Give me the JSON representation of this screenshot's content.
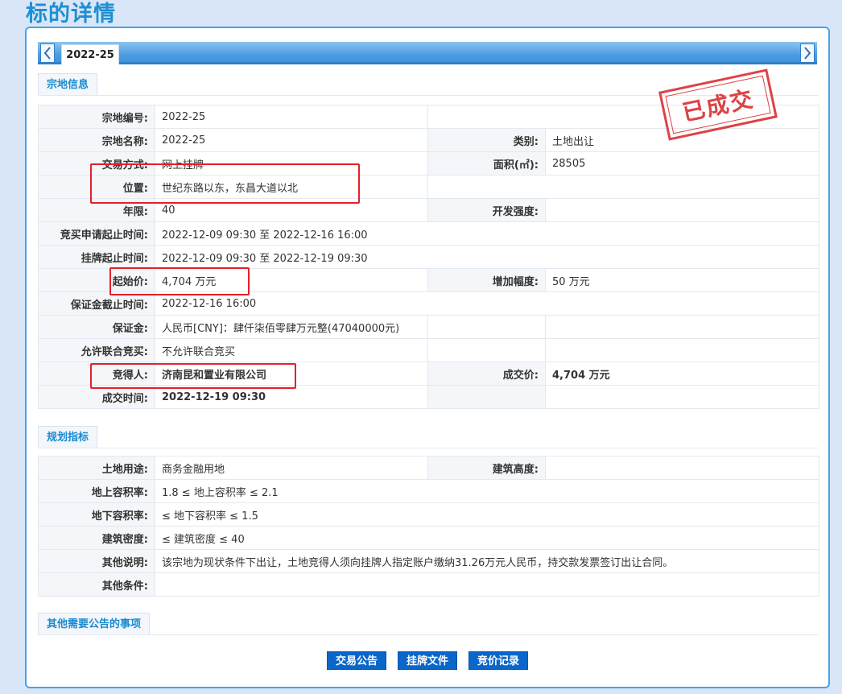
{
  "page_title": "标的详情",
  "tab": {
    "label": "2022-25"
  },
  "sections": {
    "parcel": "宗地信息",
    "planning": "规划指标",
    "other_notice": "其他需要公告的事项"
  },
  "stamp": "已成交",
  "parcel": {
    "code_label": "宗地编号:",
    "code": "2022-25",
    "name_label": "宗地名称:",
    "name": "2022-25",
    "category_label": "类别:",
    "category": "土地出让",
    "trade_label": "交易方式:",
    "trade": "网上挂牌",
    "area_label": "面积(㎡):",
    "area": "28505",
    "location_label": "位置:",
    "location": "世纪东路以东，东昌大道以北",
    "term_label": "年限:",
    "term": "40",
    "intensity_label": "开发强度:",
    "intensity": "",
    "apply_label": "竞买申请起止时间:",
    "apply": "2022-12-09 09:30 至 2022-12-16 16:00",
    "listing_label": "挂牌起止时间:",
    "listing": "2022-12-09 09:30 至 2022-12-19 09:30",
    "start_price_label": "起始价:",
    "start_price": "4,704 万元",
    "increment_label": "增加幅度:",
    "increment": "50 万元",
    "deposit_deadline_label": "保证金截止时间:",
    "deposit_deadline": "2022-12-16 16:00",
    "deposit_label": "保证金:",
    "deposit": "人民币[CNY]：肆仟柒佰零肆万元整(47040000元)",
    "joint_label": "允许联合竞买:",
    "joint": "不允许联合竞买",
    "winner_label": "竞得人:",
    "winner": "济南昆和置业有限公司",
    "deal_price_label": "成交价:",
    "deal_price": "4,704 万元",
    "deal_time_label": "成交时间:",
    "deal_time": "2022-12-19 09:30"
  },
  "planning": {
    "use_label": "土地用途:",
    "use": "商务金融用地",
    "height_label": "建筑高度:",
    "height": "",
    "far_above_label": "地上容积率:",
    "far_above": "1.8 ≤ 地上容积率 ≤ 2.1",
    "far_below_label": "地下容积率:",
    "far_below": "≤ 地下容积率 ≤ 1.5",
    "density_label": "建筑密度:",
    "density": "≤ 建筑密度 ≤ 40",
    "notes_label": "其他说明:",
    "notes": "该宗地为现状条件下出让，土地竞得人须向挂牌人指定账户缴纳31.26万元人民币，持交款发票签订出让合同。",
    "conditions_label": "其他条件:",
    "conditions": ""
  },
  "buttons": {
    "announcement": "交易公告",
    "listing_doc": "挂牌文件",
    "bid_record": "竞价记录"
  },
  "colors": {
    "accent": "#1e8fd3",
    "highlight_box": "#e3202a",
    "stamp": "#d9292e",
    "button": "#0a66c9"
  }
}
